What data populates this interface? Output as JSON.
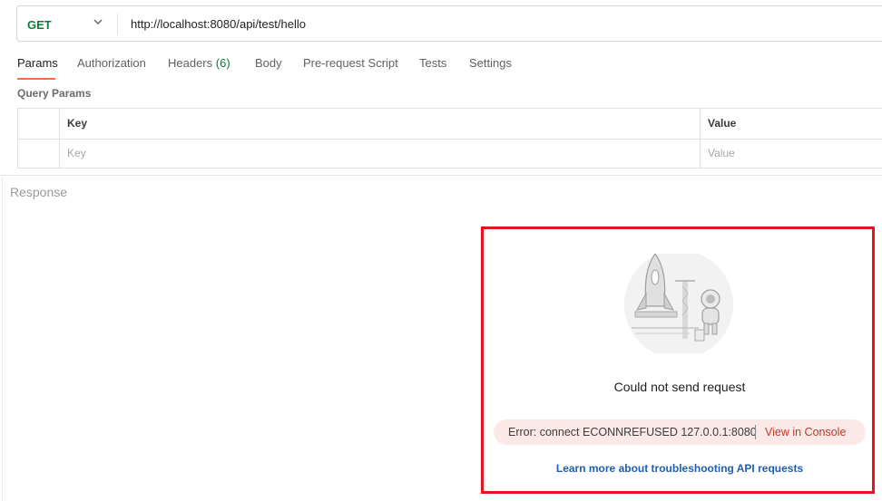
{
  "request": {
    "method": "GET",
    "url": "http://localhost:8080/api/test/hello"
  },
  "tabs": [
    {
      "label": "Params",
      "active": true
    },
    {
      "label": "Authorization"
    },
    {
      "label": "Headers",
      "count": "(6)"
    },
    {
      "label": "Body"
    },
    {
      "label": "Pre-request Script"
    },
    {
      "label": "Tests"
    },
    {
      "label": "Settings"
    }
  ],
  "query_params": {
    "title": "Query Params",
    "headers": {
      "key": "Key",
      "value": "Value"
    },
    "placeholders": {
      "key": "Key",
      "value": "Value"
    }
  },
  "response": {
    "title": "Response",
    "error_title": "Could not send request",
    "error_message": "Error: connect ECONNREFUSED 127.0.0.1:8080",
    "console_link": "View in Console",
    "learn_more": "Learn more about troubleshooting API requests"
  },
  "colors": {
    "method": "#0f7a3a",
    "active_tab_underline": "#ff6c37",
    "highlight_border": "#e8141c",
    "error_pill": "#fbe9e7",
    "console_link": "#c0392b",
    "learn_link": "#1f5fb3"
  },
  "icons": [
    "chevron-down-icon",
    "rocket-astronaut-illustration"
  ]
}
